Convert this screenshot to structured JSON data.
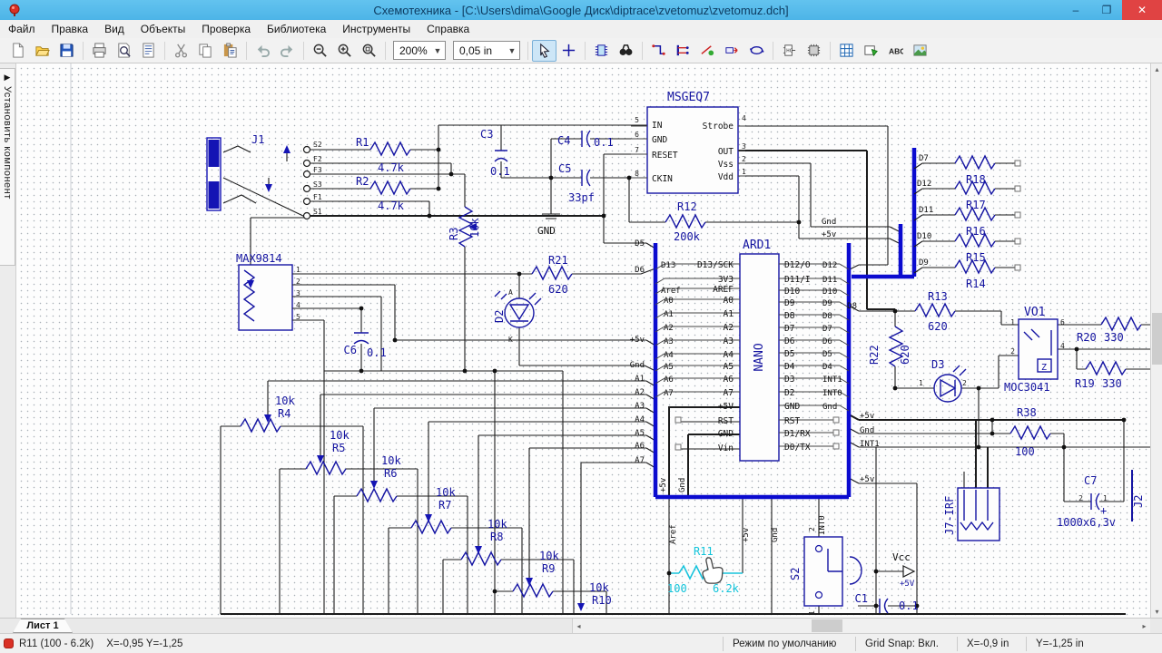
{
  "window": {
    "title": "Схемотехника - [C:\\Users\\dima\\Google Диск\\diptrace\\zvetomuz\\zvetomuz.dch]",
    "minimize": "–",
    "restore": "❐",
    "close": "✕"
  },
  "menu": {
    "items": [
      "Файл",
      "Правка",
      "Вид",
      "Объекты",
      "Проверка",
      "Библиотека",
      "Инструменты",
      "Справка"
    ]
  },
  "toolbar": {
    "zoom_value": "200%",
    "grid_value": "0,05 in",
    "left_groups": [
      [
        "new",
        "open",
        "save"
      ],
      [
        "print",
        "preview",
        "sheet"
      ],
      [
        "cut",
        "copy",
        "paste"
      ],
      [
        "undo",
        "redo"
      ],
      [
        "zoomout",
        "zoomin",
        "zoomfit"
      ]
    ],
    "right_groups": [
      [
        "cursor",
        "cross"
      ],
      [
        "chip",
        "find"
      ],
      [
        "wire",
        "bus",
        "wiredot",
        "netport",
        "loop"
      ],
      [
        "gate",
        "chip2"
      ],
      [
        "grid",
        "shape",
        "text",
        "image"
      ]
    ],
    "selected": "cursor"
  },
  "sidebar": {
    "arrow": "▶",
    "tab_label": "Установить компонент"
  },
  "sheet_tabs": {
    "active": "Лист 1"
  },
  "scrollbars": {
    "left": "◂",
    "right": "▸",
    "up": "▴",
    "down": "▾"
  },
  "statusbar": {
    "selection": "R11 (100 - 6.2k)",
    "coords": "X=-0,95  Y=-1,25",
    "mode": "Режим по умолчанию",
    "grid_snap": "Grid Snap: Вкл.",
    "x": "X=-0,9 in",
    "y": "Y=-1,25 in"
  },
  "schematic": {
    "labels": [
      [
        "J1",
        277,
        158,
        "ref"
      ],
      [
        "R1",
        392,
        161,
        "ref"
      ],
      [
        "4.7k",
        416,
        189,
        "ref"
      ],
      [
        "R2",
        392,
        204,
        "ref"
      ],
      [
        "4.7k",
        416,
        231,
        "ref"
      ],
      [
        "S2",
        345,
        162,
        "num"
      ],
      [
        "F2",
        345,
        178,
        "num"
      ],
      [
        "F3",
        345,
        190,
        "num"
      ],
      [
        "S3",
        345,
        206,
        "num"
      ],
      [
        "F1",
        345,
        220,
        "num"
      ],
      [
        "S1",
        345,
        236,
        "num"
      ],
      [
        "R3",
        504,
        265,
        "ref",
        -90
      ],
      [
        "10k",
        527,
        262,
        "ref",
        -90
      ],
      [
        "C3",
        529,
        152,
        "ref"
      ],
      [
        "0.1",
        540,
        193,
        "ref"
      ],
      [
        "C4",
        614,
        159,
        "ref"
      ],
      [
        "0.1",
        654,
        161,
        "ref"
      ],
      [
        "C5",
        615,
        190,
        "ref"
      ],
      [
        "33pf",
        626,
        222,
        "ref"
      ],
      [
        "GND",
        592,
        258,
        "blk"
      ],
      [
        "MSGEQ7",
        735,
        111,
        "big"
      ],
      [
        "IN",
        718,
        141,
        "pin"
      ],
      [
        "GND",
        718,
        157,
        "pin"
      ],
      [
        "RESET",
        718,
        174,
        "pin"
      ],
      [
        "CKIN",
        718,
        200,
        "pin"
      ],
      [
        "Strobe",
        808,
        142,
        "pin",
        0,
        "e"
      ],
      [
        "OUT",
        808,
        170,
        "pin",
        0,
        "e"
      ],
      [
        "Vss",
        808,
        184,
        "pin",
        0,
        "e"
      ],
      [
        "Vdd",
        808,
        198,
        "pin",
        0,
        "e"
      ],
      [
        "5",
        704,
        135,
        "num",
        0,
        "e"
      ],
      [
        "6",
        704,
        151,
        "num",
        0,
        "e"
      ],
      [
        "7",
        704,
        168,
        "num",
        0,
        "e"
      ],
      [
        "8",
        704,
        194,
        "num",
        0,
        "e"
      ],
      [
        "4",
        817,
        133,
        "num"
      ],
      [
        "3",
        817,
        164,
        "num"
      ],
      [
        "2",
        817,
        178,
        "num"
      ],
      [
        "1",
        817,
        192,
        "num"
      ],
      [
        "R12",
        746,
        232,
        "ref"
      ],
      [
        "200k",
        742,
        265,
        "ref"
      ],
      [
        "R21",
        604,
        291,
        "ref"
      ],
      [
        "620",
        604,
        323,
        "ref"
      ],
      [
        "D2",
        554,
        356,
        "ref",
        -90
      ],
      [
        "A",
        560,
        325,
        "num"
      ],
      [
        "K",
        560,
        377,
        "num"
      ],
      [
        "MAX9814",
        260,
        289,
        "ref"
      ],
      [
        "1",
        326,
        300,
        "num"
      ],
      [
        "2",
        326,
        313,
        "num"
      ],
      [
        "3",
        326,
        326,
        "num"
      ],
      [
        "4",
        326,
        339,
        "num"
      ],
      [
        "5",
        326,
        352,
        "num"
      ],
      [
        "C6",
        393,
        390,
        "ref",
        0,
        "e"
      ],
      [
        "0.1",
        404,
        393,
        "ref"
      ],
      [
        "10k",
        303,
        446,
        "ref"
      ],
      [
        "R4",
        306,
        460,
        "ref"
      ],
      [
        "10k",
        363,
        484,
        "ref"
      ],
      [
        "R5",
        366,
        498,
        "ref"
      ],
      [
        "10k",
        420,
        512,
        "ref"
      ],
      [
        "R6",
        423,
        526,
        "ref"
      ],
      [
        "10k",
        480,
        547,
        "ref"
      ],
      [
        "R7",
        483,
        561,
        "ref"
      ],
      [
        "10k",
        537,
        582,
        "ref"
      ],
      [
        "R8",
        540,
        596,
        "ref"
      ],
      [
        "10k",
        594,
        617,
        "ref"
      ],
      [
        "R9",
        597,
        631,
        "ref"
      ],
      [
        "10k",
        649,
        652,
        "ref"
      ],
      [
        "R10",
        652,
        666,
        "ref"
      ],
      [
        "ARD1",
        818,
        274,
        "big"
      ],
      [
        "NANO",
        840,
        394,
        "big",
        -90,
        "m"
      ],
      [
        "D13/SCK",
        808,
        295,
        "pin",
        0,
        "e"
      ],
      [
        "3V3",
        808,
        311,
        "pin",
        0,
        "e"
      ],
      [
        "AREF",
        808,
        322,
        "pin",
        0,
        "e"
      ],
      [
        "A0",
        808,
        334,
        "pin",
        0,
        "e"
      ],
      [
        "A1",
        808,
        349,
        "pin",
        0,
        "e"
      ],
      [
        "A2",
        808,
        364,
        "pin",
        0,
        "e"
      ],
      [
        "A3",
        808,
        379,
        "pin",
        0,
        "e"
      ],
      [
        "A4",
        808,
        394,
        "pin",
        0,
        "e"
      ],
      [
        "A5",
        808,
        407,
        "pin",
        0,
        "e"
      ],
      [
        "A6",
        808,
        421,
        "pin",
        0,
        "e"
      ],
      [
        "A7",
        808,
        436,
        "pin",
        0,
        "e"
      ],
      [
        "+5V",
        808,
        451,
        "pin",
        0,
        "e"
      ],
      [
        "RST",
        808,
        467,
        "pin",
        0,
        "e"
      ],
      [
        "GND",
        808,
        481,
        "pin",
        0,
        "e"
      ],
      [
        "Vin",
        808,
        497,
        "pin",
        0,
        "e"
      ],
      [
        "D12/O",
        864,
        295,
        "pin"
      ],
      [
        "D11/I",
        864,
        311,
        "pin"
      ],
      [
        "D10",
        864,
        324,
        "pin"
      ],
      [
        "D9",
        864,
        337,
        "pin"
      ],
      [
        "D8",
        864,
        351,
        "pin"
      ],
      [
        "D7",
        864,
        365,
        "pin"
      ],
      [
        "D6",
        864,
        379,
        "pin"
      ],
      [
        "D5",
        864,
        393,
        "pin"
      ],
      [
        "D4",
        864,
        407,
        "pin"
      ],
      [
        "D3",
        864,
        421,
        "pin"
      ],
      [
        "D2",
        864,
        436,
        "pin"
      ],
      [
        "GND",
        864,
        451,
        "pin"
      ],
      [
        "RST",
        864,
        467,
        "pin"
      ],
      [
        "D1/RX",
        864,
        481,
        "pin"
      ],
      [
        "D0/TX",
        864,
        496,
        "pin"
      ],
      [
        "D13",
        728,
        295,
        "net"
      ],
      [
        "Aref",
        728,
        323,
        "net"
      ],
      [
        "A0",
        731,
        334,
        "net"
      ],
      [
        "A1",
        731,
        349,
        "net"
      ],
      [
        "A2",
        731,
        364,
        "net"
      ],
      [
        "A3",
        731,
        379,
        "net"
      ],
      [
        "A4",
        731,
        394,
        "net"
      ],
      [
        "A5",
        731,
        407,
        "net"
      ],
      [
        "A6",
        731,
        421,
        "net"
      ],
      [
        "A7",
        731,
        436,
        "net"
      ],
      [
        "D12",
        906,
        295,
        "net"
      ],
      [
        "D11",
        906,
        311,
        "net"
      ],
      [
        "D10",
        906,
        324,
        "net"
      ],
      [
        "D9",
        906,
        337,
        "net"
      ],
      [
        "D8",
        906,
        351,
        "net"
      ],
      [
        "D7",
        906,
        365,
        "net"
      ],
      [
        "D6",
        906,
        379,
        "net"
      ],
      [
        "D5",
        906,
        393,
        "net"
      ],
      [
        "D4",
        906,
        407,
        "net"
      ],
      [
        "INT1",
        906,
        421,
        "net"
      ],
      [
        "INT0",
        906,
        436,
        "net"
      ],
      [
        "Gnd",
        906,
        451,
        "net"
      ],
      [
        "D5",
        710,
        271,
        "net",
        0,
        "e"
      ],
      [
        "D6",
        710,
        300,
        "net",
        0,
        "e"
      ],
      [
        "+5v",
        710,
        377,
        "net",
        0,
        "e"
      ],
      [
        "Gnd",
        710,
        405,
        "net",
        0,
        "e"
      ],
      [
        "A1",
        710,
        420,
        "net",
        0,
        "e"
      ],
      [
        "A2",
        710,
        435,
        "net",
        0,
        "e"
      ],
      [
        "A3",
        710,
        450,
        "net",
        0,
        "e"
      ],
      [
        "A4",
        710,
        465,
        "net",
        0,
        "e"
      ],
      [
        "A5",
        710,
        480,
        "net",
        0,
        "e"
      ],
      [
        "A6",
        710,
        494,
        "net",
        0,
        "e"
      ],
      [
        "A7",
        710,
        510,
        "net",
        0,
        "e"
      ],
      [
        "Gnd",
        905,
        247,
        "net"
      ],
      [
        "+5v",
        905,
        261,
        "net"
      ],
      [
        "+5v",
        947,
        461,
        "net"
      ],
      [
        "Gnd",
        947,
        477,
        "net"
      ],
      [
        "INT1",
        947,
        492,
        "net"
      ],
      [
        "+5v",
        947,
        531,
        "net"
      ],
      [
        "D8",
        944,
        340,
        "net",
        0,
        "e"
      ],
      [
        "+5v",
        733,
        543,
        "net",
        -90
      ],
      [
        "Gnd",
        754,
        543,
        "net",
        -90
      ],
      [
        "Aref",
        744,
        600,
        "net",
        -90
      ],
      [
        "+5v",
        824,
        598,
        "net",
        -90
      ],
      [
        "Gnd",
        856,
        598,
        "net",
        -90
      ],
      [
        "INT0",
        908,
        590,
        "net",
        -90
      ],
      [
        "D7",
        1012,
        177,
        "net"
      ],
      [
        "D12",
        1010,
        205,
        "net"
      ],
      [
        "D11",
        1012,
        234,
        "net"
      ],
      [
        "D10",
        1010,
        263,
        "net"
      ],
      [
        "D9",
        1012,
        292,
        "net"
      ],
      [
        "R18",
        1064,
        202,
        "ref"
      ],
      [
        "R17",
        1064,
        230,
        "ref"
      ],
      [
        "R16",
        1064,
        259,
        "ref"
      ],
      [
        "R15",
        1064,
        288,
        "ref"
      ],
      [
        "R14",
        1064,
        317,
        "ref"
      ],
      [
        "R13",
        1022,
        331,
        "ref"
      ],
      [
        "620",
        1022,
        364,
        "ref"
      ],
      [
        "R22",
        967,
        402,
        "ref",
        -90
      ],
      [
        "620",
        1001,
        402,
        "ref",
        -90
      ],
      [
        "D3",
        1026,
        406,
        "ref"
      ],
      [
        "1",
        1012,
        425,
        "num"
      ],
      [
        "2",
        1060,
        425,
        "num"
      ],
      [
        "VO1",
        1128,
        348,
        "big"
      ],
      [
        "MOC3041",
        1106,
        431,
        "ref"
      ],
      [
        "Z",
        1147,
        408,
        "z"
      ],
      [
        "1",
        1118,
        358,
        "num",
        0,
        "e"
      ],
      [
        "2",
        1118,
        390,
        "num",
        0,
        "e"
      ],
      [
        "6",
        1168,
        358,
        "num"
      ],
      [
        "4",
        1168,
        384,
        "num"
      ],
      [
        "R20",
        1186,
        376,
        "ref"
      ],
      [
        "330",
        1216,
        376,
        "ref"
      ],
      [
        "R19",
        1184,
        427,
        "ref"
      ],
      [
        "330",
        1214,
        427,
        "ref"
      ],
      [
        "R38",
        1120,
        459,
        "ref"
      ],
      [
        "100",
        1118,
        502,
        "ref"
      ],
      [
        "R11",
        764,
        612,
        "cyan"
      ],
      [
        "100",
        735,
        653,
        "cyan"
      ],
      [
        "6.2k",
        785,
        653,
        "cyan"
      ],
      [
        "S2",
        880,
        640,
        "ref",
        -90
      ],
      [
        "2",
        897,
        586,
        "num",
        -90
      ],
      [
        "1",
        897,
        678,
        "num",
        -90
      ],
      [
        "Vcc",
        983,
        618,
        "blk"
      ],
      [
        "+5V",
        991,
        646,
        "nv9"
      ],
      [
        "C1",
        956,
        664,
        "ref",
        0,
        "e"
      ],
      [
        "0.1",
        990,
        672,
        "ref"
      ],
      [
        "C7",
        1194,
        534,
        "ref"
      ],
      [
        "2",
        1193,
        552,
        "num",
        0,
        "e"
      ],
      [
        "1",
        1215,
        552,
        "num"
      ],
      [
        "+",
        1212,
        567,
        "ref"
      ],
      [
        "1000x6,3v",
        1164,
        580,
        "ref"
      ],
      [
        "J7-IRF",
        1050,
        590,
        "ref",
        -90
      ],
      [
        "J2",
        1258,
        560,
        "ref",
        -90
      ]
    ]
  }
}
